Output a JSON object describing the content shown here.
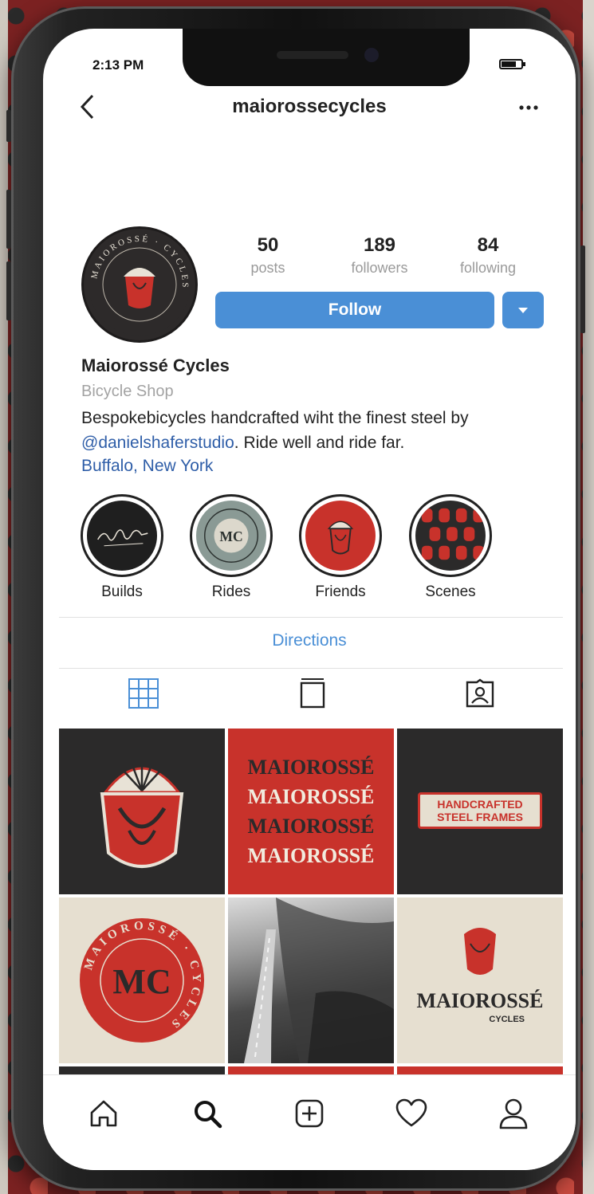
{
  "status_bar": {
    "time": "2:13 PM",
    "battery_level": 0.8
  },
  "nav": {
    "title": "maiorossecycles"
  },
  "profile": {
    "stats": [
      {
        "value": "50",
        "label": "posts"
      },
      {
        "value": "189",
        "label": "followers"
      },
      {
        "value": "84",
        "label": "following"
      }
    ],
    "follow_label": "Follow",
    "name": "Maiorossé Cycles",
    "category": "Bicycle Shop",
    "bio_part1": "Bespokebicycles handcrafted wiht the finest steel by ",
    "bio_mention": "@danielshaferstudio",
    "bio_part2": ". Ride well and ride far.",
    "location": "Buffalo, New York",
    "avatar_text": "MAIOROSSÉ · CYCLES"
  },
  "highlights": [
    {
      "label": "Builds"
    },
    {
      "label": "Rides",
      "logo_text": "MC"
    },
    {
      "label": "Friends"
    },
    {
      "label": "Scenes"
    }
  ],
  "directions_label": "Directions",
  "posts": {
    "wordmark_lines": [
      "MAIOROSSÉ",
      "MAIOROSSÉ",
      "MAIOROSSÉ",
      "MAIOROSSÉ"
    ],
    "badge_line1": "HANDCRAFTED",
    "badge_line2": "STEEL FRAMES",
    "seal_monogram": "MC",
    "seal_ring_text": "MAIOROSSÉ · CYCLES",
    "brand_name": "MAIOROSSÉ",
    "brand_sub": "CYCLES"
  },
  "colors": {
    "accent_blue": "#4a8fd6",
    "brand_red": "#c8322b",
    "brand_dark": "#2b2a2a",
    "brand_cream": "#e6dfd0"
  },
  "icons": {
    "tabs": [
      "grid-icon",
      "igtv-icon",
      "tagged-icon"
    ],
    "bottom_nav": [
      "home-icon",
      "search-icon",
      "add-post-icon",
      "heart-icon",
      "profile-icon"
    ]
  }
}
